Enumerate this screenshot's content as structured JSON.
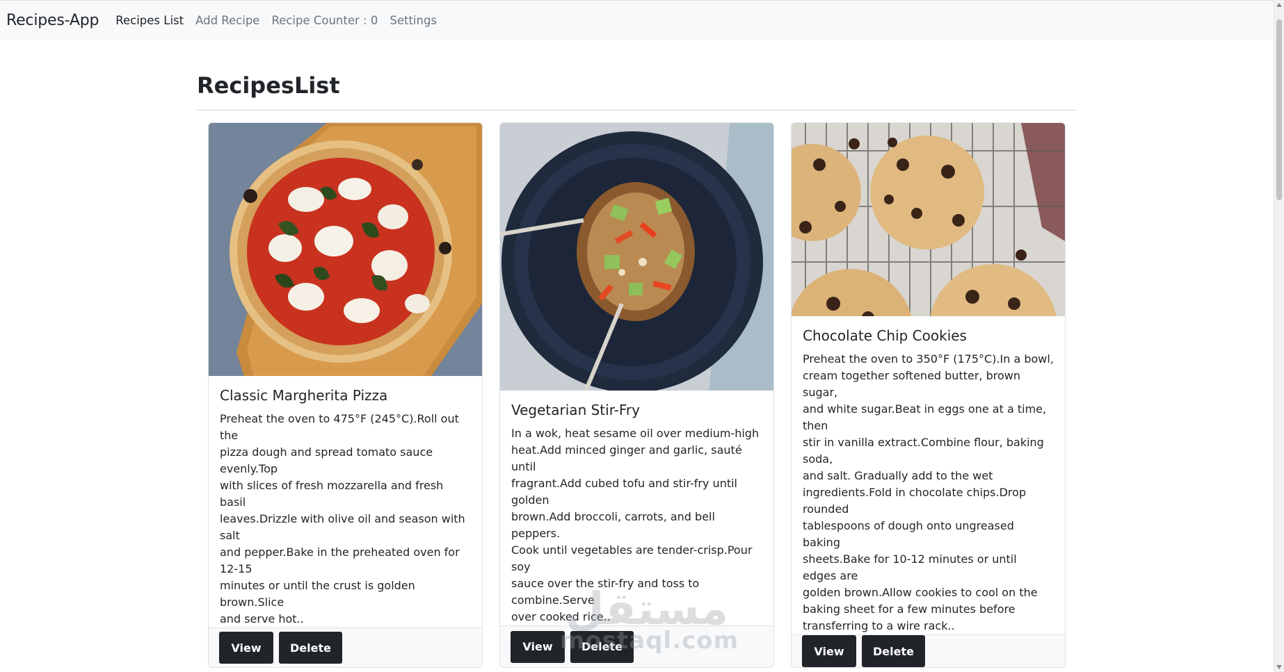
{
  "navbar": {
    "brand": "Recipes-App",
    "links": [
      {
        "label": "Recipes List",
        "active": true
      },
      {
        "label": "Add Recipe",
        "active": false
      },
      {
        "label": "Recipe Counter : 0",
        "active": false
      },
      {
        "label": "Settings",
        "active": false
      }
    ]
  },
  "page": {
    "title": "RecipesList"
  },
  "recipes": [
    {
      "title": "Classic Margherita Pizza",
      "text": "Preheat the oven to 475°F (245°C).Roll out the\npizza dough and spread tomato sauce evenly.Top\nwith slices of fresh mozzarella and fresh basil\nleaves.Drizzle with olive oil and season with salt\nand pepper.Bake in the preheated oven for 12-15\nminutes or until the crust is golden brown.Slice\nand serve hot..",
      "image": "pizza-image",
      "view_label": "View",
      "delete_label": "Delete"
    },
    {
      "title": "Vegetarian Stir-Fry",
      "text": "In a wok, heat sesame oil over medium-high\nheat.Add minced ginger and garlic, sauté until\nfragrant.Add cubed tofu and stir-fry until golden\nbrown.Add broccoli, carrots, and bell peppers.\nCook until vegetables are tender-crisp.Pour soy\nsauce over the stir-fry and toss to combine.Serve\nover cooked rice..",
      "image": "stir-fry-image",
      "view_label": "View",
      "delete_label": "Delete"
    },
    {
      "title": "Chocolate Chip Cookies",
      "text": "Preheat the oven to 350°F (175°C).In a bowl,\ncream together softened butter, brown sugar,\nand white sugar.Beat in eggs one at a time, then\nstir in vanilla extract.Combine flour, baking soda,\nand salt. Gradually add to the wet\ningredients.Fold in chocolate chips.Drop rounded\ntablespoons of dough onto ungreased baking\nsheets.Bake for 10-12 minutes or until edges are\ngolden brown.Allow cookies to cool on the\nbaking sheet for a few minutes before\ntransferring to a wire rack..",
      "image": "cookies-image",
      "view_label": "View",
      "delete_label": "Delete"
    }
  ],
  "watermark": {
    "arabic": "مستقل",
    "latin": "mostaql.com"
  },
  "colors": {
    "navbar_bg": "#f8f9fa",
    "button_bg": "#212529",
    "button_text": "#ffffff",
    "text": "#212529",
    "muted": "#6c757d"
  }
}
